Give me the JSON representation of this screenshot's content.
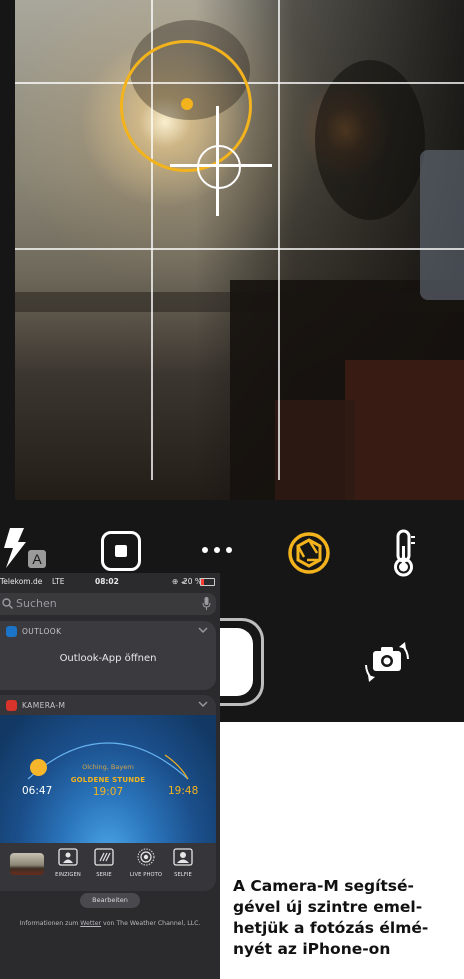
{
  "camera": {
    "toolbar": {
      "flash_mode": "A",
      "icons": [
        "flash-icon",
        "stop-icon",
        "more-icon",
        "aperture-icon",
        "thermometer-icon"
      ]
    },
    "controls": [
      "shutter-button",
      "flip-camera-icon"
    ],
    "overlay_colors": {
      "sun_marker": "#f3b31d",
      "grid": "#ffffff"
    }
  },
  "phone": {
    "status": {
      "carrier": "Telekom.de",
      "network": "LTE",
      "time": "08:02",
      "battery": "20 %"
    },
    "search": {
      "placeholder": "Suchen"
    },
    "widgets": {
      "outlook": {
        "title": "OUTLOOK",
        "action": "Outlook-App öffnen"
      },
      "kamera": {
        "title": "KAMERA-M",
        "location": "Olching, Bayern",
        "golden_hour_label": "GOLDENE STUNDE",
        "golden_hour_time": "19:07",
        "sunrise": "06:47",
        "sunset": "19:48",
        "modes": [
          {
            "label": "EINZIGEN",
            "icon": "single-person-icon"
          },
          {
            "label": "SERIE",
            "icon": "burst-icon"
          },
          {
            "label": "LIVE PHOTO",
            "icon": "live-photo-icon"
          },
          {
            "label": "SELFIE",
            "icon": "selfie-icon"
          }
        ]
      }
    },
    "edit_button": "Bearbeiten",
    "info": {
      "prefix": "Informationen zum ",
      "link": "Wetter",
      "suffix": " von The Weather Channel, LLC."
    }
  },
  "caption": {
    "lines": [
      "A Camera-M segítsé-",
      "gével új szintre emel-",
      "hetjük a fotózás élmé-",
      "nyét az iPhone-on"
    ]
  },
  "colors": {
    "accent": "#f3b31d",
    "outlook_blue": "#1b74c8",
    "kamera_red": "#d9342b"
  }
}
